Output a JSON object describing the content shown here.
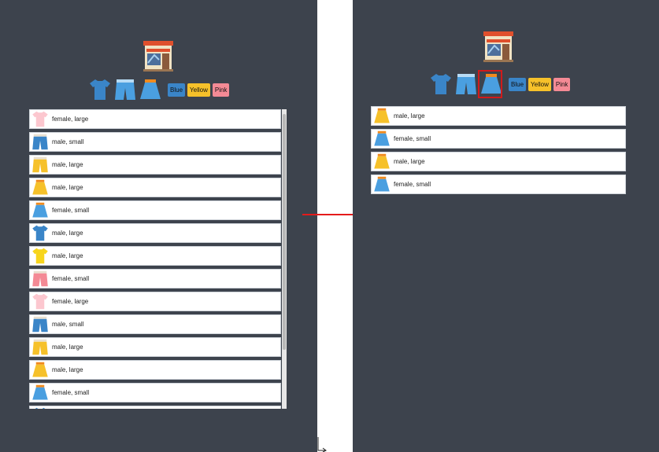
{
  "filters": {
    "icons": [
      "shirt-icon",
      "shorts-icon",
      "skirt-icon"
    ],
    "selected_icon": "skirt-icon",
    "colors": [
      {
        "label": "Blue",
        "hex": "#3a85c8"
      },
      {
        "label": "Yellow",
        "hex": "#f6c12a"
      },
      {
        "label": "Pink",
        "hex": "#f48a95"
      }
    ]
  },
  "left_list": [
    {
      "icon": "shirt",
      "color": "#fcc7cf",
      "label": "female, large"
    },
    {
      "icon": "shorts",
      "color": "#3a85c8",
      "label": "male, small"
    },
    {
      "icon": "shorts",
      "color": "#f6c12a",
      "label": "male, large"
    },
    {
      "icon": "skirt",
      "color": "#f6c12a",
      "label": "male, large"
    },
    {
      "icon": "skirt",
      "color": "#4a9fe0",
      "label": "female, small"
    },
    {
      "icon": "shirt",
      "color": "#3a85c8",
      "label": "male, large"
    },
    {
      "icon": "shirt",
      "color": "#f7d51c",
      "label": "male, large"
    },
    {
      "icon": "shorts",
      "color": "#f48a95",
      "label": "female, small"
    },
    {
      "icon": "shirt",
      "color": "#fcc7cf",
      "label": "female, large"
    },
    {
      "icon": "shorts",
      "color": "#3a85c8",
      "label": "male, small"
    },
    {
      "icon": "shorts",
      "color": "#f6c12a",
      "label": "male, large"
    },
    {
      "icon": "skirt",
      "color": "#f6c12a",
      "label": "male, large"
    },
    {
      "icon": "skirt",
      "color": "#4a9fe0",
      "label": "female, small"
    },
    {
      "icon": "shirt",
      "color": "#3a85c8",
      "label": ""
    }
  ],
  "right_list": [
    {
      "icon": "skirt",
      "color": "#f6c12a",
      "label": "male, large"
    },
    {
      "icon": "skirt",
      "color": "#4a9fe0",
      "label": "female, small"
    },
    {
      "icon": "skirt",
      "color": "#f6c12a",
      "label": "male, large"
    },
    {
      "icon": "skirt",
      "color": "#4a9fe0",
      "label": "female, small"
    }
  ]
}
